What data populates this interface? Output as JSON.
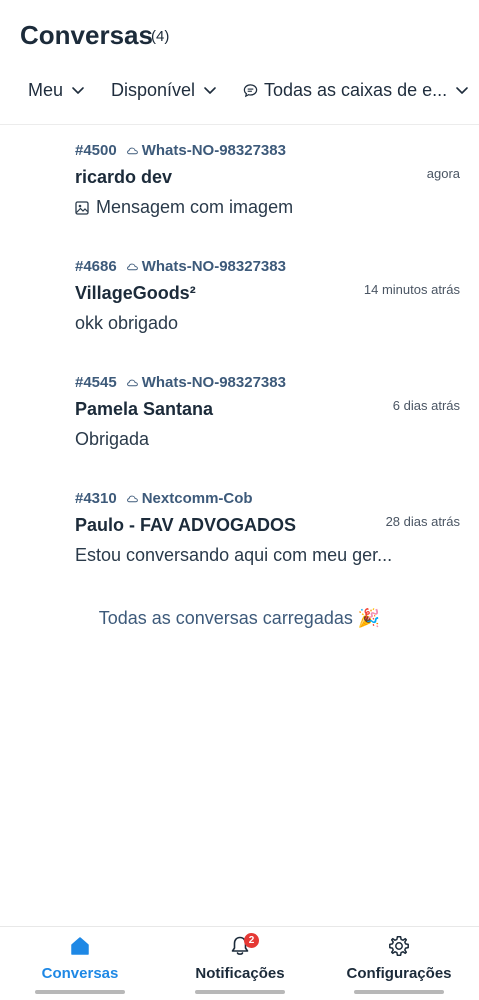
{
  "header": {
    "title": "Conversas",
    "count": "(4)"
  },
  "filters": {
    "assignee": "Meu",
    "status": "Disponível",
    "inbox": "Todas as caixas de e..."
  },
  "conversations": [
    {
      "id": "#4500",
      "inbox": "Whats-NO-98327383",
      "name": "ricardo dev",
      "time": "agora",
      "preview": "Mensagem com imagem",
      "has_image_icon": true
    },
    {
      "id": "#4686",
      "inbox": "Whats-NO-98327383",
      "name": "VillageGoods²",
      "time": "14 minutos atrás",
      "preview": "okk obrigado",
      "has_image_icon": false
    },
    {
      "id": "#4545",
      "inbox": "Whats-NO-98327383",
      "name": "Pamela Santana",
      "time": "6 dias atrás",
      "preview": "Obrigada",
      "has_image_icon": false
    },
    {
      "id": "#4310",
      "inbox": "Nextcomm-Cob",
      "name": "Paulo - FAV ADVOGADOS",
      "time": "28 dias atrás",
      "preview": "Estou conversando aqui com meu ger...",
      "has_image_icon": false
    }
  ],
  "footer_message": "Todas as conversas carregadas 🎉",
  "bottom_nav": {
    "tabs": [
      {
        "label": "Conversas",
        "icon": "home-icon",
        "active": true
      },
      {
        "label": "Notificações",
        "icon": "bell-icon",
        "badge": "2"
      },
      {
        "label": "Configurações",
        "icon": "gear-icon"
      }
    ]
  },
  "colors": {
    "accent": "#1e88e5",
    "meta_text": "#3d5a7a",
    "badge": "#e53935"
  }
}
